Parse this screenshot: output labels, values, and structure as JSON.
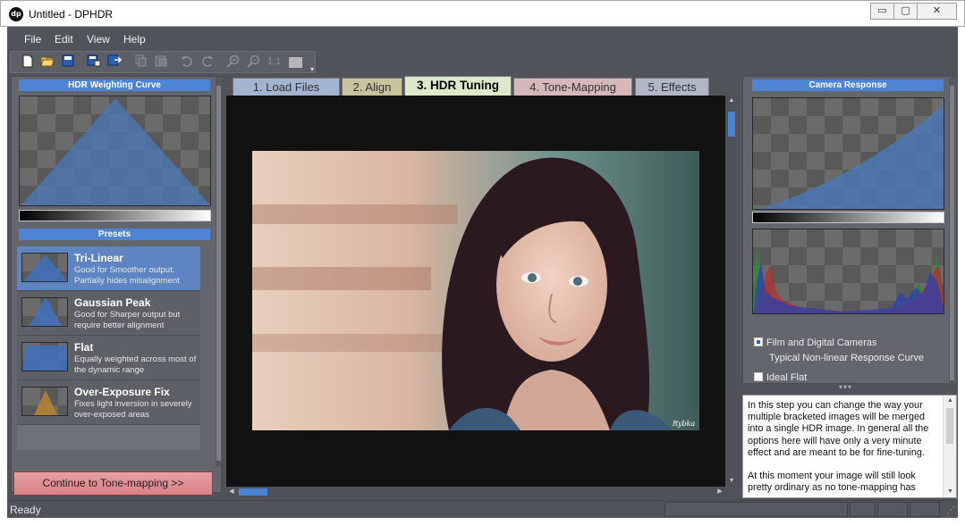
{
  "window": {
    "app_icon_text": "dp",
    "title": "Untitled - DPHDR",
    "buttons": {
      "minimize": "▭",
      "maximize": "▢",
      "close": "✕"
    }
  },
  "menu": [
    "File",
    "Edit",
    "View",
    "Help"
  ],
  "toolbar": {
    "zoom_label": "1:1",
    "icons": [
      "new-file-icon",
      "open-folder-icon",
      "save-icon",
      "save-as-icon",
      "export-icon",
      "copy-icon",
      "paste-icon",
      "undo-icon",
      "redo-icon",
      "zoom-in-icon",
      "zoom-out-icon"
    ]
  },
  "left_panel": {
    "weighting_header": "HDR Weighting Curve",
    "presets_header": "Presets",
    "presets": [
      {
        "name": "Tri-Linear",
        "desc": "Good for Smoother output. Partially hides misalignment",
        "selected": true,
        "color": "#3f72c4"
      },
      {
        "name": "Gaussian Peak",
        "desc": "Good for Sharper output but require better alignment",
        "selected": false,
        "color": "#3f72c4"
      },
      {
        "name": "Flat",
        "desc": "Equally weighted across most of the dynamic range",
        "selected": false,
        "color": "#3f72c4"
      },
      {
        "name": "Over-Exposure Fix",
        "desc": "Fixes light inversion in severely over-exposed areas",
        "selected": false,
        "color": "#b57f35"
      }
    ],
    "continue_button": "Continue to Tone-mapping >>"
  },
  "tabs": [
    {
      "label": "1. Load Files",
      "active": false,
      "color": "#a2b4d0"
    },
    {
      "label": "2. Align",
      "active": false,
      "color": "#c8c29f"
    },
    {
      "label": "3. HDR Tuning",
      "active": true,
      "color": "#dce9c9"
    },
    {
      "label": "4. Tone-Mapping",
      "active": false,
      "color": "#d7b8ba"
    },
    {
      "label": "5. Effects",
      "active": false,
      "color": "#b0b8c8"
    }
  ],
  "photo": {
    "signature": "Rybka"
  },
  "right_panel": {
    "header": "Camera Response",
    "options": [
      {
        "label": "Film and Digital Cameras",
        "checked": true
      },
      {
        "label": "Typical Non-linear Response Curve",
        "checked": false,
        "sub": true
      },
      {
        "label": "Ideal Flat",
        "checked": false
      }
    ]
  },
  "info": {
    "paragraph1": "In this step you can change the way your multiple bracketed images will be merged into a single HDR image. In general all the options here will have only a very minute effect and are meant to be for fine-tuning.",
    "paragraph2": "At this moment your image will still look pretty ordinary as no tone-mapping has"
  },
  "status": {
    "text": "Ready"
  },
  "colors": {
    "accent": "#4f84d4",
    "panel": "#63666d",
    "chrome": "#50535a",
    "continue": "#d88186"
  }
}
